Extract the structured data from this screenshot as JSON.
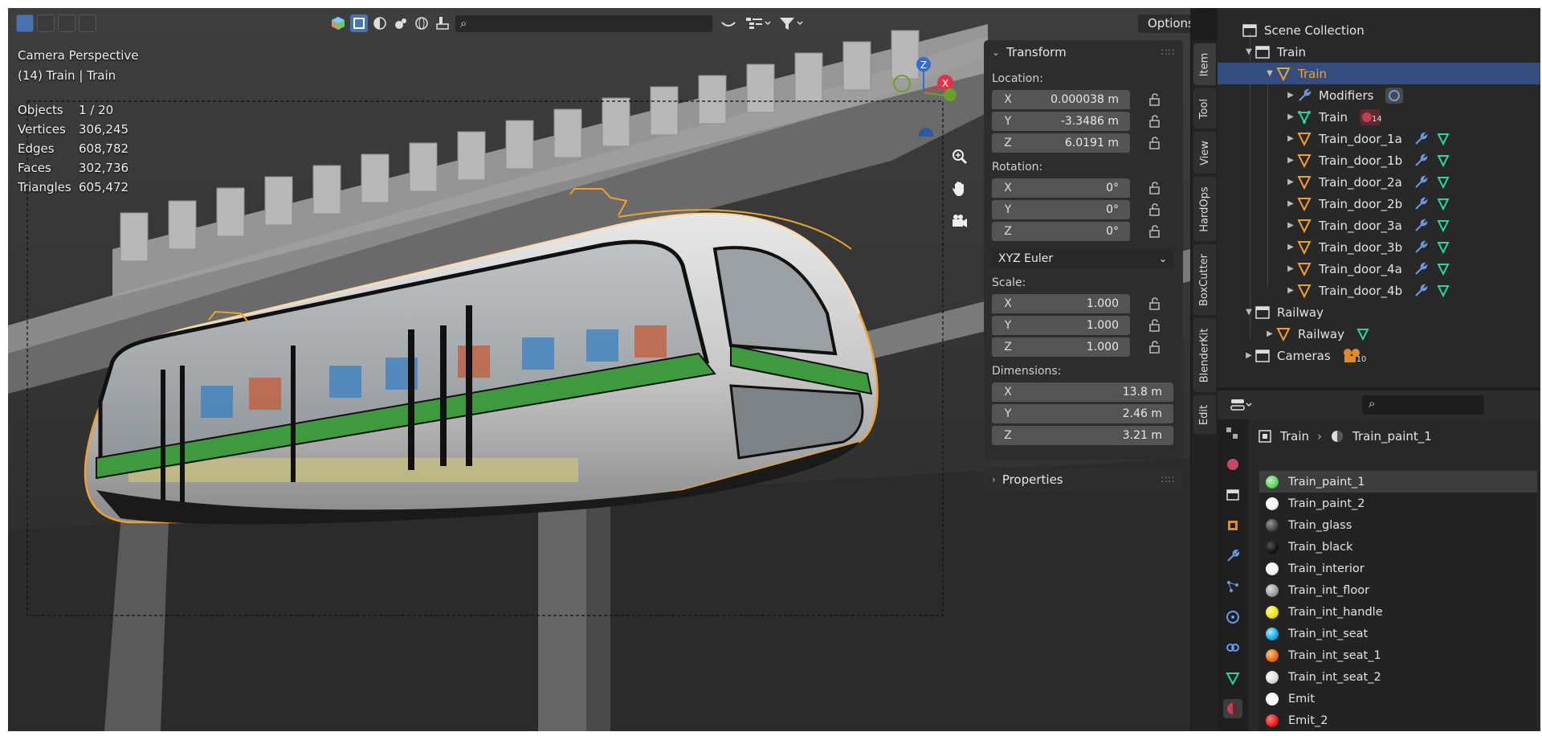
{
  "viewport": {
    "title": "Camera Perspective",
    "subtitle": "(14) Train | Train",
    "search_placeholder": "",
    "options_label": "Options",
    "stats": [
      {
        "label": "Objects",
        "value": "1 / 20"
      },
      {
        "label": "Vertices",
        "value": "306,245"
      },
      {
        "label": "Edges",
        "value": "608,782"
      },
      {
        "label": "Faces",
        "value": "302,736"
      },
      {
        "label": "Triangles",
        "value": "605,472"
      }
    ],
    "gizmo": {
      "z": "Z",
      "x": "X",
      "y": "Y"
    }
  },
  "npanel": {
    "transform_title": "Transform",
    "location_label": "Location:",
    "location": [
      {
        "axis": "X",
        "value": "0.000038 m"
      },
      {
        "axis": "Y",
        "value": "-3.3486 m"
      },
      {
        "axis": "Z",
        "value": "6.0191 m"
      }
    ],
    "rotation_label": "Rotation:",
    "rotation": [
      {
        "axis": "X",
        "value": "0°"
      },
      {
        "axis": "Y",
        "value": "0°"
      },
      {
        "axis": "Z",
        "value": "0°"
      }
    ],
    "rotation_mode": "XYZ Euler",
    "scale_label": "Scale:",
    "scale": [
      {
        "axis": "X",
        "value": "1.000"
      },
      {
        "axis": "Y",
        "value": "1.000"
      },
      {
        "axis": "Z",
        "value": "1.000"
      }
    ],
    "dimensions_label": "Dimensions:",
    "dimensions": [
      {
        "axis": "X",
        "value": "13.8 m"
      },
      {
        "axis": "Y",
        "value": "2.46 m"
      },
      {
        "axis": "Z",
        "value": "3.21 m"
      }
    ],
    "properties_title": "Properties"
  },
  "vtabs": [
    "Item",
    "Tool",
    "View",
    "HardOps",
    "BoxCutter",
    "BlenderKit",
    "Edit"
  ],
  "outliner": {
    "rows": [
      {
        "name": "Scene Collection",
        "type": "scene"
      },
      {
        "name": "Train",
        "type": "collection"
      },
      {
        "name": "Train",
        "type": "object",
        "selected": true
      },
      {
        "name": "Modifiers",
        "type": "modifiers"
      },
      {
        "name": "Train",
        "type": "mesh",
        "badge": "14"
      },
      {
        "name": "Train_door_1a",
        "type": "object"
      },
      {
        "name": "Train_door_1b",
        "type": "object"
      },
      {
        "name": "Train_door_2a",
        "type": "object"
      },
      {
        "name": "Train_door_2b",
        "type": "object"
      },
      {
        "name": "Train_door_3a",
        "type": "object"
      },
      {
        "name": "Train_door_3b",
        "type": "object"
      },
      {
        "name": "Train_door_4a",
        "type": "object"
      },
      {
        "name": "Train_door_4b",
        "type": "object"
      },
      {
        "name": "Railway",
        "type": "collection"
      },
      {
        "name": "Railway",
        "type": "object"
      },
      {
        "name": "Cameras",
        "type": "collection",
        "badge": "10"
      }
    ]
  },
  "properties": {
    "breadcrumb_object": "Train",
    "breadcrumb_material": "Train_paint_1",
    "materials": [
      {
        "name": "Train_paint_1",
        "color": "#5fd35f"
      },
      {
        "name": "Train_paint_2",
        "color": "#f2f2f2"
      },
      {
        "name": "Train_glass",
        "color": "#444444"
      },
      {
        "name": "Train_black",
        "color": "#151515"
      },
      {
        "name": "Train_interior",
        "color": "#f5f5f5"
      },
      {
        "name": "Train_int_floor",
        "color": "#9a9a9a"
      },
      {
        "name": "Train_int_handle",
        "color": "#f0e000"
      },
      {
        "name": "Train_int_seat",
        "color": "#14a8e8"
      },
      {
        "name": "Train_int_seat_1",
        "color": "#e86a10"
      },
      {
        "name": "Train_int_seat_2",
        "color": "#d8d8d8"
      },
      {
        "name": "Emit",
        "color": "#ffffff"
      },
      {
        "name": "Emit_2",
        "color": "#e81a1a"
      }
    ]
  },
  "colors": {
    "selection_blue": "#334d80",
    "accent_orange": "#f0a030",
    "stripe_green": "#3f9a3f"
  }
}
